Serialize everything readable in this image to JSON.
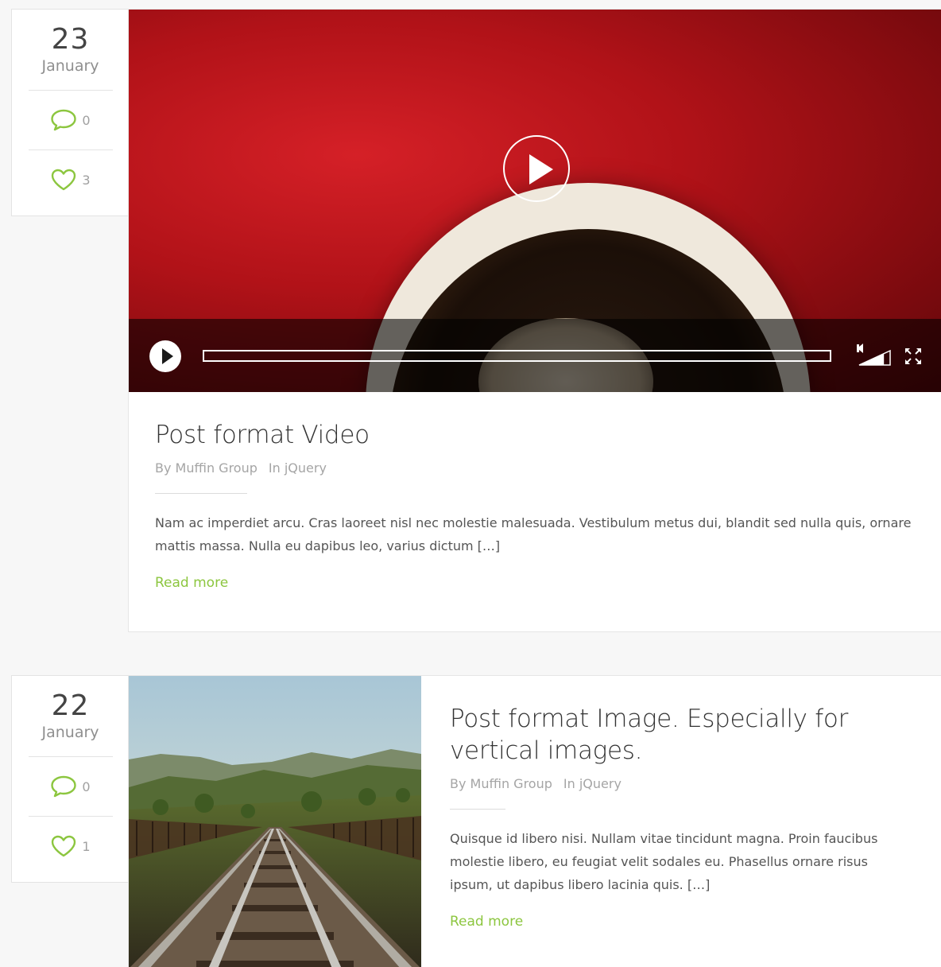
{
  "posts": [
    {
      "day": "23",
      "month": "January",
      "comments": "0",
      "likes": "3",
      "title": "Post format Video",
      "author": "By Muffin Group",
      "category": "In jQuery",
      "excerpt": "Nam ac imperdiet arcu. Cras laoreet nisl nec molestie malesuada. Vestibulum metus dui, blandit sed nulla quis, ornare mattis massa. Nulla eu dapibus leo, varius dictum […]",
      "read_more": "Read more",
      "video": {
        "progress_fraction": 0,
        "volume_fraction": 0.8
      }
    },
    {
      "day": "22",
      "month": "January",
      "comments": "0",
      "likes": "1",
      "title": "Post format Image. Especially for vertical images.",
      "author": "By Muffin Group",
      "category": "In jQuery",
      "excerpt": "Quisque id libero nisi. Nullam vitae tincidunt magna. Proin faucibus molestie libero, eu feugiat velit sodales eu. Phasellus ornare risus ipsum, ut dapibus libero lacinia quis. […]",
      "read_more": "Read more"
    }
  ],
  "icons": {
    "comment": "comment-bubble-icon",
    "like": "heart-icon",
    "play": "play-icon",
    "volume": "volume-icon",
    "fullscreen": "fullscreen-icon"
  },
  "colors": {
    "accent": "#8cc63f",
    "video_bg": "#b11218",
    "page_bg": "#f7f7f7"
  }
}
